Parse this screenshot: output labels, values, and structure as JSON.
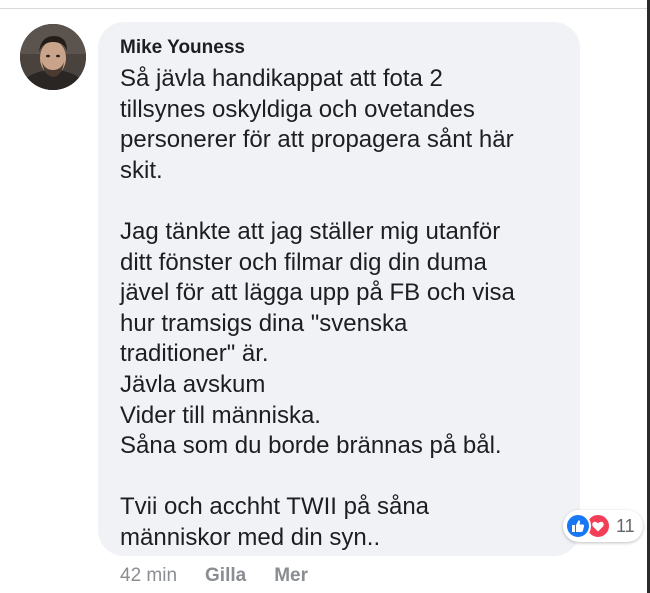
{
  "comment": {
    "author": "Mike Youness",
    "text": "Så jävla handikappat att fota 2\ntillsynes oskyldiga och ovetandes\npersonerer för att propagera sånt här\nskit.\n\nJag tänkte att jag ställer mig utanför\nditt fönster och filmar dig din duma\njävel för att lägga upp på FB och visa\nhur tramsigs dina \"svenska\ntraditioner\" är.\nJävla avskum\nVider till människa.\nSåna som du borde brännas på bål.\n\nTvii och acchht TWII på såna\nmänniskor med din syn..",
    "reactions": {
      "icons": [
        "like-icon",
        "love-icon"
      ],
      "count": "11",
      "like_color": "#1877f2",
      "love_color": "#f33e58"
    },
    "actions": {
      "time": "42 min",
      "like_label": "Gilla",
      "more_label": "Mer"
    }
  },
  "colors": {
    "bubble_background": "#f0f2f5",
    "text": "#1c1e21",
    "muted": "#8a8d91"
  }
}
